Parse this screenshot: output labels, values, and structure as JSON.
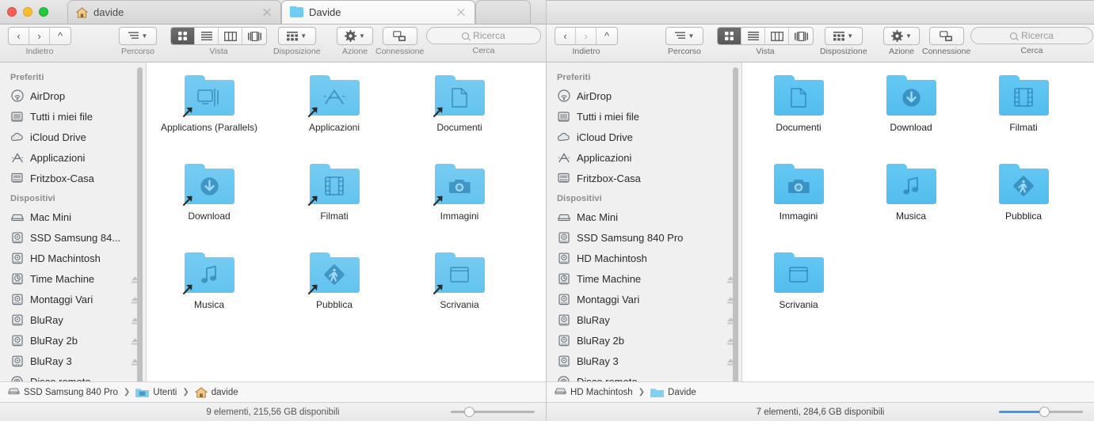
{
  "theme": {
    "accent_blue": "#3d9ae8",
    "folder_blue_active": "#63c6f2",
    "folder_blue_inactive": "#74cbf2",
    "traffic_close": "#ff5f57",
    "traffic_min": "#ffbd2e",
    "traffic_max": "#28c940",
    "sidebar_bg": "#f0f0f1"
  },
  "window_left": {
    "tabs": [
      {
        "label": "davide",
        "icon": "home-icon",
        "active": false,
        "closable": true
      },
      {
        "label": "Davide",
        "icon": "folder-icon",
        "active": true,
        "closable": true
      }
    ],
    "toolbar": {
      "back_forward_label": "Indietro",
      "path_label": "Percorso",
      "view_label": "Vista",
      "arrange_label": "Disposizione",
      "action_label": "Azione",
      "share_label": "Connessione",
      "search_label": "Cerca",
      "search_placeholder": "Ricerca",
      "view_modes": [
        "icon-view",
        "list-view",
        "column-view",
        "coverflow-view"
      ],
      "view_selected": 0
    },
    "sidebar": {
      "sections": [
        {
          "title": "Preferiti",
          "items": [
            {
              "label": "AirDrop",
              "icon": "airdrop-icon",
              "eject": false
            },
            {
              "label": "Tutti i miei file",
              "icon": "all-files-icon",
              "eject": false
            },
            {
              "label": "iCloud Drive",
              "icon": "icloud-icon",
              "eject": false
            },
            {
              "label": "Applicazioni",
              "icon": "applications-icon",
              "eject": false
            },
            {
              "label": "Fritzbox-Casa",
              "icon": "server-icon",
              "eject": false
            }
          ]
        },
        {
          "title": "Dispositivi",
          "items": [
            {
              "label": "Mac Mini",
              "icon": "computer-icon",
              "eject": false
            },
            {
              "label": "SSD Samsung 84...",
              "icon": "harddisk-icon",
              "eject": false
            },
            {
              "label": "HD Machintosh",
              "icon": "harddisk-icon",
              "eject": false
            },
            {
              "label": "Time Machine",
              "icon": "timemachine-icon",
              "eject": true
            },
            {
              "label": "Montaggi Vari",
              "icon": "harddisk-icon",
              "eject": true
            },
            {
              "label": "BluRay",
              "icon": "harddisk-icon",
              "eject": true
            },
            {
              "label": "BluRay 2b",
              "icon": "harddisk-icon",
              "eject": true
            },
            {
              "label": "BluRay 3",
              "icon": "harddisk-icon",
              "eject": true
            },
            {
              "label": "Disco remoto",
              "icon": "disc-icon",
              "eject": false
            }
          ]
        }
      ]
    },
    "files": [
      {
        "name": "Applications (Parallels)",
        "glyph": "parallels-glyph",
        "alias": true
      },
      {
        "name": "Applicazioni",
        "glyph": "appstore-glyph",
        "alias": true
      },
      {
        "name": "Documenti",
        "glyph": "document-glyph",
        "alias": true
      },
      {
        "name": "Download",
        "glyph": "download-glyph",
        "alias": true
      },
      {
        "name": "Filmati",
        "glyph": "film-glyph",
        "alias": true
      },
      {
        "name": "Immagini",
        "glyph": "camera-glyph",
        "alias": true
      },
      {
        "name": "Musica",
        "glyph": "music-glyph",
        "alias": true
      },
      {
        "name": "Pubblica",
        "glyph": "public-glyph",
        "alias": true
      },
      {
        "name": "Scrivania",
        "glyph": "desktop-glyph",
        "alias": true
      }
    ],
    "path_bar": [
      {
        "label": "SSD Samsung 840 Pro",
        "icon": "harddisk-icon"
      },
      {
        "label": "Utenti",
        "icon": "users-folder-icon"
      },
      {
        "label": "davide",
        "icon": "home-icon"
      }
    ],
    "status": "9 elementi, 215,56 GB disponibili",
    "zoom_slider": {
      "value": 18,
      "active": false
    }
  },
  "window_right": {
    "tabs": [
      {
        "label": "",
        "icon": "none",
        "active": false,
        "closable": false
      }
    ],
    "toolbar": {
      "back_forward_label": "Indietro",
      "path_label": "Percorso",
      "view_label": "Vista",
      "arrange_label": "Disposizione",
      "action_label": "Azione",
      "share_label": "Connessione",
      "search_label": "Cerca",
      "search_placeholder": "Ricerca",
      "view_modes": [
        "icon-view",
        "list-view",
        "column-view",
        "coverflow-view"
      ],
      "view_selected": 0
    },
    "sidebar": {
      "sections": [
        {
          "title": "Preferiti",
          "items": [
            {
              "label": "AirDrop",
              "icon": "airdrop-icon",
              "eject": false
            },
            {
              "label": "Tutti i miei file",
              "icon": "all-files-icon",
              "eject": false
            },
            {
              "label": "iCloud Drive",
              "icon": "icloud-icon",
              "eject": false
            },
            {
              "label": "Applicazioni",
              "icon": "applications-icon",
              "eject": false
            },
            {
              "label": "Fritzbox-Casa",
              "icon": "server-icon",
              "eject": false
            }
          ]
        },
        {
          "title": "Dispositivi",
          "items": [
            {
              "label": "Mac Mini",
              "icon": "computer-icon",
              "eject": false
            },
            {
              "label": "SSD Samsung 840 Pro",
              "icon": "harddisk-icon",
              "eject": false
            },
            {
              "label": "HD Machintosh",
              "icon": "harddisk-icon",
              "eject": false
            },
            {
              "label": "Time Machine",
              "icon": "timemachine-icon",
              "eject": true
            },
            {
              "label": "Montaggi Vari",
              "icon": "harddisk-icon",
              "eject": true
            },
            {
              "label": "BluRay",
              "icon": "harddisk-icon",
              "eject": true
            },
            {
              "label": "BluRay 2b",
              "icon": "harddisk-icon",
              "eject": true
            },
            {
              "label": "BluRay 3",
              "icon": "harddisk-icon",
              "eject": true
            },
            {
              "label": "Disco remoto",
              "icon": "disc-icon",
              "eject": false
            }
          ]
        }
      ]
    },
    "files": [
      {
        "name": "Documenti",
        "glyph": "document-glyph",
        "alias": false
      },
      {
        "name": "Download",
        "glyph": "download-glyph",
        "alias": false
      },
      {
        "name": "Filmati",
        "glyph": "film-glyph",
        "alias": false
      },
      {
        "name": "Immagini",
        "glyph": "camera-glyph",
        "alias": false
      },
      {
        "name": "Musica",
        "glyph": "music-glyph",
        "alias": false
      },
      {
        "name": "Pubblica",
        "glyph": "public-glyph",
        "alias": false
      },
      {
        "name": "Scrivania",
        "glyph": "desktop-glyph",
        "alias": false
      }
    ],
    "path_bar": [
      {
        "label": "HD Machintosh",
        "icon": "harddisk-icon"
      },
      {
        "label": "Davide",
        "icon": "folder-icon"
      }
    ],
    "status": "7 elementi, 284,6 GB disponibili",
    "zoom_slider": {
      "value": 55,
      "active": true
    }
  }
}
